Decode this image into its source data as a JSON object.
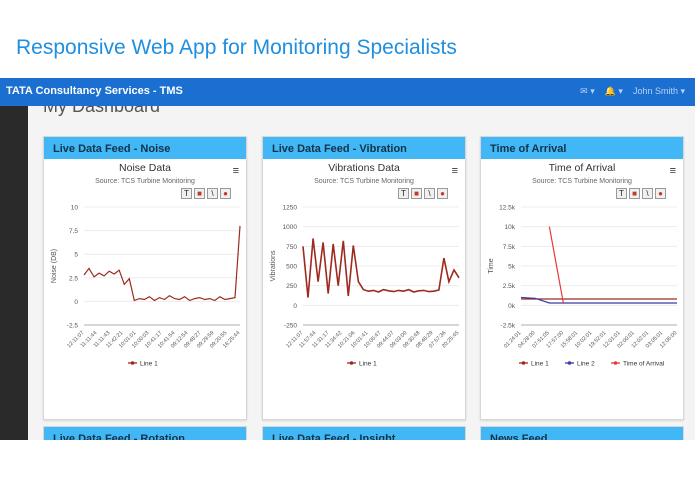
{
  "slide_title": "Responsive Web App for Monitoring Specialists",
  "navbar": {
    "brand": "TATA Consultancy Services - TMS",
    "mail_icon": "✉ ▾",
    "bell_icon": "🔔 ▾",
    "user_name": "John Smith ▾"
  },
  "dashboard": {
    "title": "My Dashboard"
  },
  "panels": [
    {
      "header": "Live Data Feed - Noise",
      "chart_title": "Noise Data",
      "source": "Source: TCS Turbine Monitoring"
    },
    {
      "header": "Live Data Feed - Vibration",
      "chart_title": "Vibrations Data",
      "source": "Source: TCS Turbine Monitoring"
    },
    {
      "header": "Time of Arrival",
      "chart_title": "Time of Arrival",
      "source": "Source: TCS Turbine Monitoring"
    }
  ],
  "bottom_panels": [
    "Live Data Feed - Rotation",
    "Live Data Feed - Insight",
    "News Feed"
  ],
  "tool_icons": {
    "text": "T",
    "square": "■",
    "line": "\\",
    "circle": "●",
    "menu": "≡"
  },
  "colors": {
    "line1": "#9e2a1f",
    "line2": "#3a3aa8",
    "time_of_arrival": "#e53935",
    "header": "#41b8f5",
    "navbar": "#1a6fd1"
  },
  "chart_data": [
    {
      "type": "line",
      "ylabel": "Noise (DB)",
      "ylim": [
        -2.5,
        10
      ],
      "yticks": [
        "10",
        "7.5",
        "5",
        "2.5",
        "0",
        "-2.5"
      ],
      "xticks": [
        "12:11:07",
        "11:11:44",
        "11:11:43",
        "11:42:21",
        "10:01:01",
        "10:00:03",
        "10:41:17",
        "10:41:54",
        "09:12:54",
        "09:48:27",
        "09:29:59",
        "09:20:55",
        "16:25:44"
      ],
      "series": [
        {
          "name": "Line 1",
          "values": [
            2.8,
            3.5,
            2.6,
            3.0,
            2.7,
            3.2,
            2.9,
            3.3,
            1.8,
            2.4,
            0.1,
            0.3,
            0.2,
            0.5,
            0.1,
            0.4,
            0.2,
            0.6,
            0.3,
            0.2,
            0.5,
            0.1,
            0.3,
            0.4,
            0.2,
            0.3,
            0.1,
            0.5,
            0.2,
            0.3,
            0.4,
            8.0
          ]
        }
      ]
    },
    {
      "type": "line",
      "ylabel": "Vibrations",
      "ylim": [
        -250,
        1250
      ],
      "yticks": [
        "1250",
        "1000",
        "750",
        "500",
        "250",
        "0",
        "-250"
      ],
      "xticks": [
        "12:11:07",
        "11:57:44",
        "11:31:17",
        "11:34:42",
        "10:21:06",
        "10:01:41",
        "10:06:47",
        "09:44:07",
        "09:03:00",
        "09:30:48",
        "08:46:29",
        "07:57:36",
        "20:25:45"
      ],
      "series": [
        {
          "name": "Line 1",
          "values": [
            750,
            100,
            850,
            300,
            800,
            150,
            780,
            250,
            820,
            120,
            760,
            300,
            200,
            180,
            190,
            170,
            200,
            185,
            175,
            190,
            180,
            200,
            170,
            185,
            190,
            175,
            180,
            195,
            600,
            300,
            450,
            350
          ]
        }
      ]
    },
    {
      "type": "line",
      "ylabel": "Time",
      "ylim": [
        -2500,
        12500
      ],
      "yticks": [
        "12.5k",
        "10k",
        "7.5k",
        "5k",
        "2.5k",
        "0k",
        "-2.5k"
      ],
      "xticks": [
        "01:24:01",
        "04:28:00",
        "07:51:05",
        "17:57:00",
        "15:58:01",
        "10:02:01",
        "19:52:01",
        "12:01:01",
        "02:00:01",
        "12:02:01",
        "03:05:01",
        "12:06:00"
      ],
      "series": [
        {
          "name": "Line 1",
          "values": [
            800,
            800,
            800,
            800,
            800,
            800,
            800,
            800,
            800,
            800,
            800,
            800
          ]
        },
        {
          "name": "Line 2",
          "values": [
            1000,
            900,
            300,
            300,
            300,
            300,
            300,
            300,
            300,
            300,
            300,
            300
          ]
        },
        {
          "name": "Time of Arrival",
          "values": [
            null,
            null,
            10000,
            200,
            null,
            null,
            null,
            null,
            null,
            null,
            null,
            null
          ]
        }
      ]
    }
  ]
}
